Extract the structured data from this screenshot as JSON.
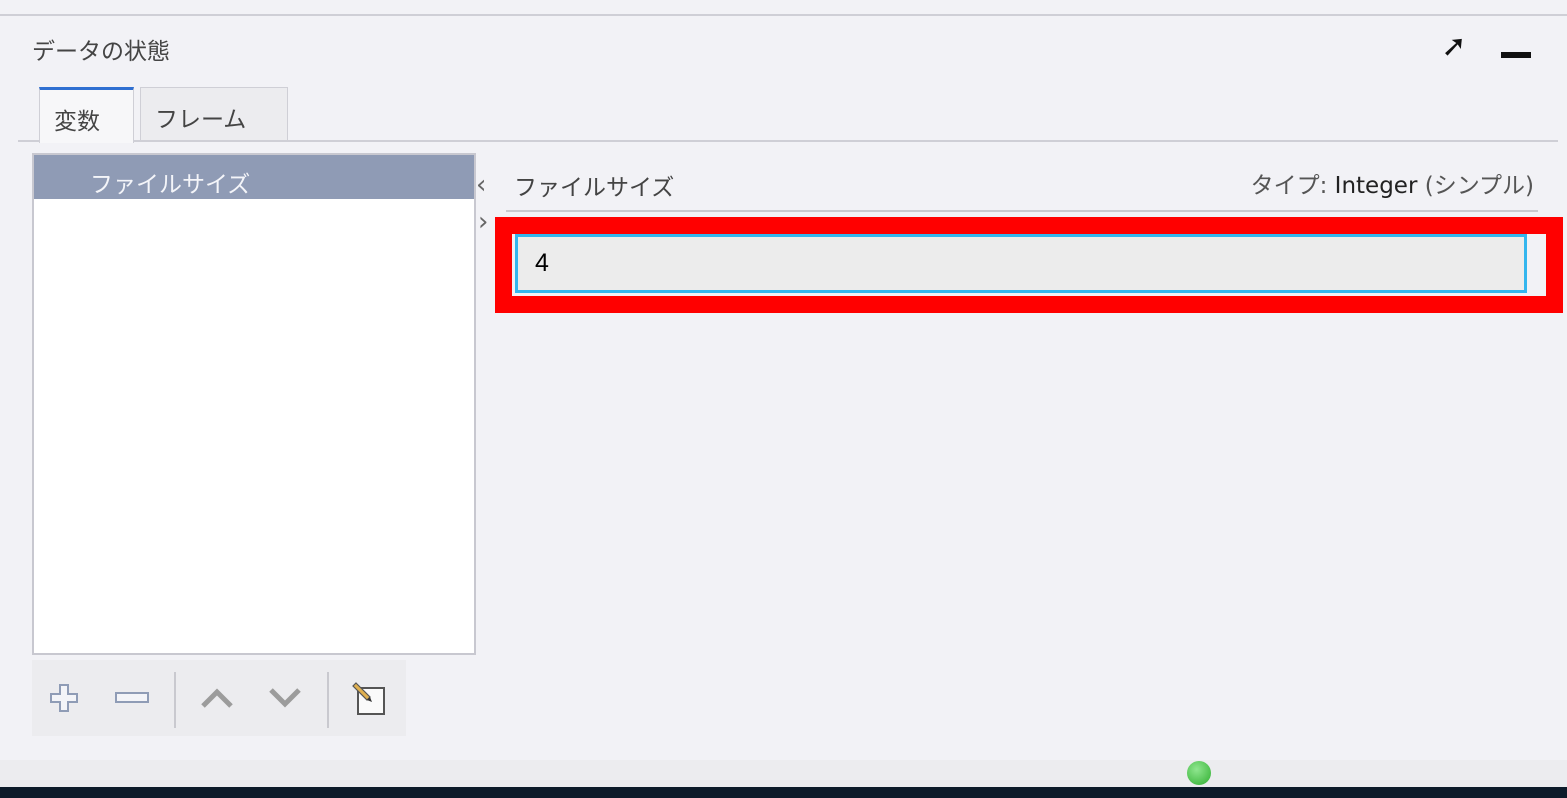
{
  "panel": {
    "title": "データの状態",
    "maximize_icon": "maximize-arrow-icon",
    "minimize_icon": "minimize-icon"
  },
  "tabs": [
    {
      "label": "変数",
      "selected": true
    },
    {
      "label": "フレーム",
      "selected": false
    }
  ],
  "variables": {
    "items": [
      {
        "label": "ファイルサイズ",
        "selected": true
      }
    ]
  },
  "toolbar": {
    "icons": [
      "add-icon",
      "remove-icon",
      "move-up-icon",
      "move-down-icon",
      "edit-icon"
    ]
  },
  "detail": {
    "name": "ファイルサイズ",
    "type_label": "タイプ: ",
    "type_value": "Integer",
    "type_kind": " (シンプル)",
    "value": "4"
  },
  "colors": {
    "highlight": "#ff0000",
    "input_focus": "#34b6ee",
    "tab_accent": "#2f6fd1",
    "selected_item": "#8f9bb5",
    "status_ok": "#2fae2f"
  }
}
